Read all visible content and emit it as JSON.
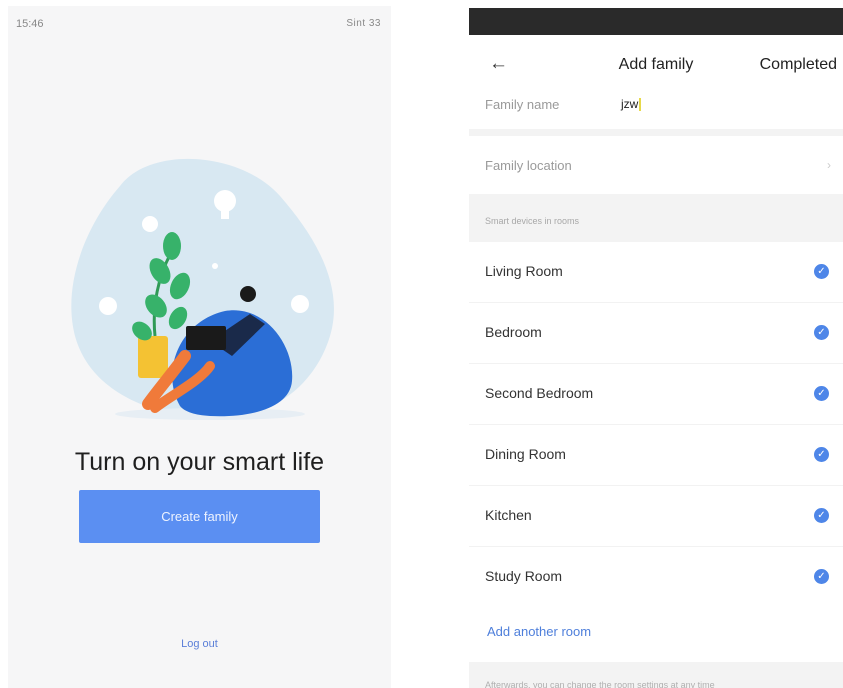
{
  "left": {
    "status_time": "15:46",
    "status_icons": "Sint  33",
    "headline": "Turn on your smart life",
    "create_button": "Create family",
    "logout": "Log out"
  },
  "right": {
    "header": {
      "title": "Add family",
      "complete_label": "Completed"
    },
    "family_name": {
      "label": "Family name",
      "value": "jzw"
    },
    "family_location": {
      "label": "Family location"
    },
    "section_header": "Smart devices in rooms",
    "rooms": [
      {
        "name": "Living Room",
        "checked": true
      },
      {
        "name": "Bedroom",
        "checked": true
      },
      {
        "name": "Second Bedroom",
        "checked": true
      },
      {
        "name": "Dining Room",
        "checked": true
      },
      {
        "name": "Kitchen",
        "checked": true
      },
      {
        "name": "Study Room",
        "checked": true
      }
    ],
    "add_room": "Add another room",
    "footer_note": "Afterwards, you can change the room settings at any time"
  },
  "colors": {
    "accent": "#5b8ff2",
    "check": "#4e86e8",
    "link": "#4e7fdb"
  },
  "icons": [
    "back-arrow-icon",
    "check-circle-icon",
    "chevron-right-icon"
  ]
}
